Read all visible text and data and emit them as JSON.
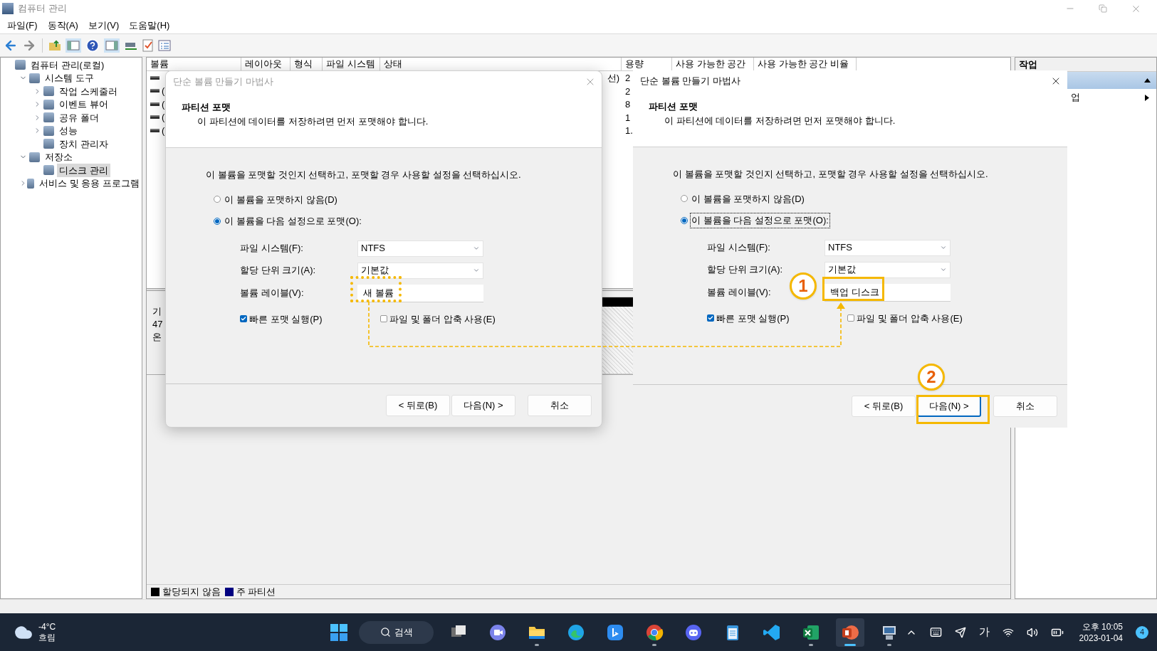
{
  "window": {
    "title": "컴퓨터 관리"
  },
  "menu": [
    "파일(F)",
    "동작(A)",
    "보기(V)",
    "도움말(H)"
  ],
  "tree": [
    {
      "label": "컴퓨터 관리(로컬)",
      "selected": false,
      "children": [
        {
          "label": "시스템 도구",
          "selected": false,
          "expanded": true,
          "children": [
            {
              "label": "작업 스케줄러",
              "selected": false,
              "expanded": false
            },
            {
              "label": "이벤트 뷰어",
              "selected": false,
              "expanded": false
            },
            {
              "label": "공유 폴더",
              "selected": false,
              "expanded": false
            },
            {
              "label": "성능",
              "selected": false,
              "expanded": false
            },
            {
              "label": "장치 관리자",
              "selected": false
            }
          ]
        },
        {
          "label": "저장소",
          "selected": false,
          "expanded": true,
          "children": [
            {
              "label": "디스크 관리",
              "selected": true
            }
          ]
        },
        {
          "label": "서비스 및 응용 프로그램",
          "selected": false,
          "expanded": false
        }
      ]
    }
  ],
  "table": {
    "columns": [
      "볼륨",
      "레이아웃",
      "형식",
      "파일 시스템",
      "상태",
      "용량",
      "사용 가능한 공간",
      "사용 가능한 공간 비율"
    ],
    "rows": [
      {
        "volume": "",
        "status": "선)",
        "capacity": "2"
      },
      {
        "volume": "(",
        "capacity": "2"
      },
      {
        "volume": "(",
        "capacity": "8"
      },
      {
        "volume": "(",
        "capacity": "1"
      },
      {
        "volume": "(",
        "capacity": "1."
      }
    ]
  },
  "disk_pane": {
    "label_lines": [
      "기",
      "47",
      "온"
    ],
    "legend": [
      {
        "label": "할당되지 않음",
        "color": "#000000"
      },
      {
        "label": "주 파티션",
        "color": "#000080"
      }
    ]
  },
  "actions": {
    "title": "작업",
    "items": [
      {
        "kind": "section",
        "expanded": true
      },
      {
        "kind": "item",
        "label": "업"
      }
    ]
  },
  "dialogs": [
    {
      "title": "단순 볼륨 만들기 마법사",
      "active": false,
      "heading": "파티션 포맷",
      "subheading": "이 파티션에 데이터를 저장하려면 먼저 포맷해야 합니다.",
      "prompt": "이 볼륨을 포맷할 것인지 선택하고, 포맷할 경우 사용할 설정을 선택하십시오.",
      "options": [
        {
          "label": "이 볼륨을 포맷하지 않음(D)",
          "selected": false,
          "focused": false
        },
        {
          "label": "이 볼륨을 다음 설정으로 포맷(O):",
          "selected": true,
          "focused": false
        }
      ],
      "fields": [
        {
          "kind": "dropdown",
          "label": "파일 시스템(F):",
          "value": "NTFS"
        },
        {
          "kind": "dropdown",
          "label": "할당 단위 크기(A):",
          "value": "기본값"
        },
        {
          "kind": "text",
          "label": "볼륨 레이블(V):",
          "value": "새 볼륨"
        }
      ],
      "checkboxes": [
        {
          "label": "빠른 포맷 실행(P)",
          "checked": true
        },
        {
          "label": "파일 및 폴더 압축 사용(E)",
          "checked": false
        }
      ],
      "buttons": [
        {
          "label": "< 뒤로(B)",
          "focused": false
        },
        {
          "label": "다음(N) >",
          "focused": false
        },
        {
          "label": "취소",
          "focused": false
        }
      ]
    },
    {
      "title": "단순 볼륨 만들기 마법사",
      "active": true,
      "heading": "파티션 포맷",
      "subheading": "이 파티션에 데이터를 저장하려면 먼저 포맷해야 합니다.",
      "prompt": "이 볼륨을 포맷할 것인지 선택하고, 포맷할 경우 사용할 설정을 선택하십시오.",
      "options": [
        {
          "label": "이 볼륨을 포맷하지 않음(D)",
          "selected": false,
          "focused": false
        },
        {
          "label": "이 볼륨을 다음 설정으로 포맷(O):",
          "selected": true,
          "focused": true
        }
      ],
      "fields": [
        {
          "kind": "dropdown",
          "label": "파일 시스템(F):",
          "value": "NTFS"
        },
        {
          "kind": "dropdown",
          "label": "할당 단위 크기(A):",
          "value": "기본값"
        },
        {
          "kind": "text",
          "label": "볼륨 레이블(V):",
          "value": "백업 디스크"
        }
      ],
      "checkboxes": [
        {
          "label": "빠른 포맷 실행(P)",
          "checked": true
        },
        {
          "label": "파일 및 폴더 압축 사용(E)",
          "checked": false
        }
      ],
      "buttons": [
        {
          "label": "< 뒤로(B)",
          "focused": false
        },
        {
          "label": "다음(N) >",
          "focused": true
        },
        {
          "label": "취소",
          "focused": false
        }
      ]
    }
  ],
  "annotations": [
    {
      "number": "1"
    },
    {
      "number": "2"
    }
  ],
  "taskbar": {
    "weather": {
      "temperature": "-4°C",
      "condition": "흐림"
    },
    "search": "검색",
    "apps": [
      {
        "kind": "task-view",
        "running": false,
        "active": false
      },
      {
        "kind": "chat",
        "running": false,
        "active": false
      },
      {
        "kind": "folder",
        "running": true,
        "active": false
      },
      {
        "kind": "edge",
        "running": false,
        "active": false
      },
      {
        "kind": "bing",
        "running": false,
        "active": false
      },
      {
        "kind": "chrome",
        "running": true,
        "active": false
      },
      {
        "kind": "discord",
        "running": false,
        "active": false
      },
      {
        "kind": "notepad",
        "running": false,
        "active": false
      },
      {
        "kind": "vscode",
        "running": false,
        "active": false
      },
      {
        "kind": "excel",
        "running": true,
        "active": false
      },
      {
        "kind": "powerpoint",
        "running": true,
        "active": true
      },
      {
        "kind": "computer",
        "running": true,
        "active": false
      }
    ],
    "tray": [
      {
        "kind": "chevron"
      },
      {
        "kind": "keyboard"
      },
      {
        "kind": "send"
      },
      {
        "kind": "ime",
        "label": "가"
      },
      {
        "kind": "wifi"
      },
      {
        "kind": "volume"
      },
      {
        "kind": "battery"
      }
    ],
    "time": "오후 10:05",
    "date": "2023-01-04",
    "badge": "4"
  }
}
